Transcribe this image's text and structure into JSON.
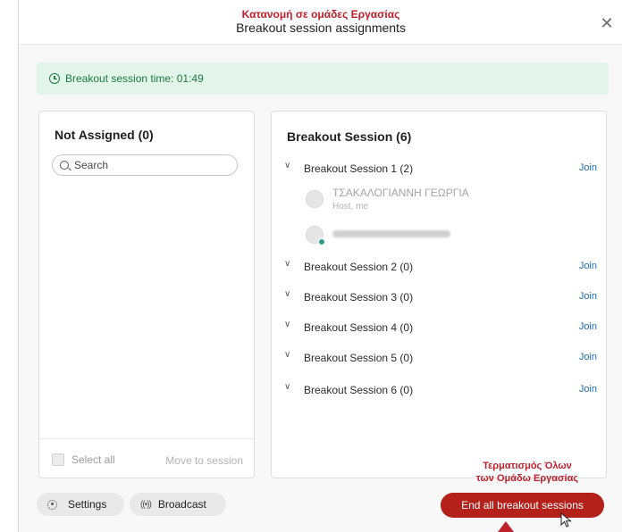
{
  "annotations": {
    "top": "Κατανομή σε ομάδες Εργασίας",
    "bottom_line1": "Τερματισμός Όλων",
    "bottom_line2": "των Ομάδω Εργασίας"
  },
  "dialog": {
    "title": "Breakout session assignments",
    "close_icon": "close-icon"
  },
  "timer": {
    "text": "Breakout session time: 01:49",
    "icon": "clock-icon"
  },
  "left_panel": {
    "heading": "Not Assigned (0)",
    "search_placeholder": "Search",
    "select_all": "Select all",
    "move_to_session": "Move to session"
  },
  "right_panel": {
    "heading": "Breakout Session  (6)",
    "join_label": "Join",
    "sessions": [
      {
        "name": "Breakout Session 1 (2)",
        "join": "Join"
      },
      {
        "name": "Breakout Session 2 (0)",
        "join": "Join"
      },
      {
        "name": "Breakout Session 3 (0)",
        "join": "Join"
      },
      {
        "name": "Breakout Session 4 (0)",
        "join": "Join"
      },
      {
        "name": "Breakout Session 5 (0)",
        "join": "Join"
      },
      {
        "name": "Breakout Session 6 (0)",
        "join": "Join"
      }
    ],
    "members": [
      {
        "name": "ΤΣΑΚΑΛΟΓΙΑΝΝΗ ΓΕΩΡΓΙΑ",
        "role": "Host, me"
      },
      {
        "name": "",
        "role": ""
      }
    ]
  },
  "footer": {
    "settings": "Settings",
    "broadcast": "Broadcast",
    "end_all": "End all breakout sessions"
  },
  "colors": {
    "accent_red": "#b4201a",
    "annotation_red": "#c0202a",
    "link_blue": "#1e6dc2",
    "timer_green": "#1b7a43",
    "timer_bg": "#e3f5ea"
  }
}
